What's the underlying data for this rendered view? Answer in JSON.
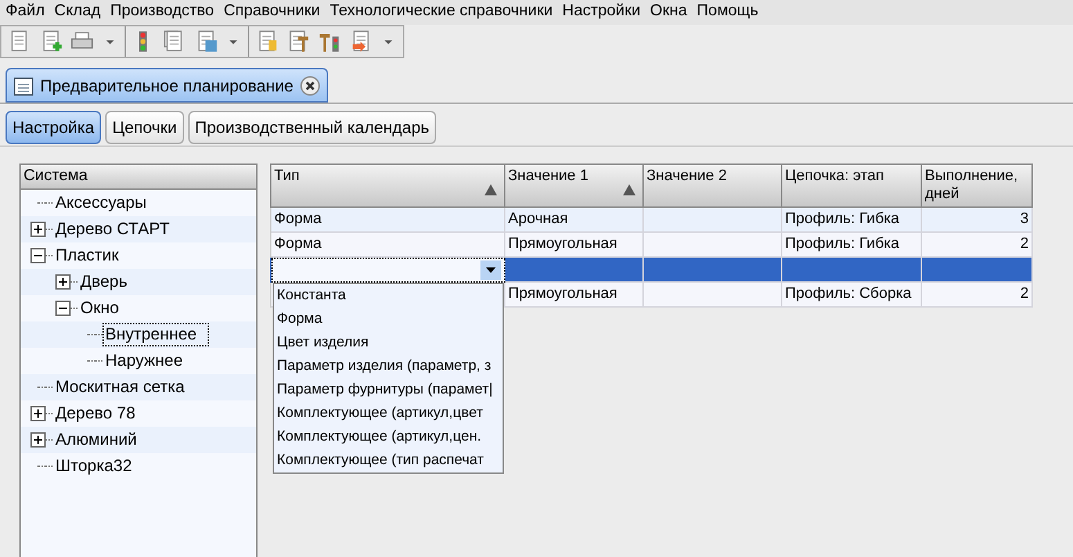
{
  "menu": [
    "Файл",
    "Склад",
    "Производство",
    "Справочники",
    "Технологические справочники",
    "Настройки",
    "Окна",
    "Помощь"
  ],
  "document_tab": {
    "title": "Предварительное планирование",
    "selected": true
  },
  "tabs": [
    {
      "label": "Настройка",
      "selected": true
    },
    {
      "label": "Цепочки",
      "selected": false
    },
    {
      "label": "Производственный календарь",
      "selected": false
    }
  ],
  "tree": {
    "header": "Система",
    "items": [
      {
        "label": "Аксессуары",
        "selected": false
      },
      {
        "label": "Дерево СТАРТ",
        "selected": false,
        "expanded": false
      },
      {
        "label": "Пластик",
        "selected": false,
        "expanded": true,
        "children": [
          {
            "label": "Дверь",
            "selected": false,
            "expanded": false
          },
          {
            "label": "Окно",
            "selected": false,
            "expanded": true,
            "children": [
              {
                "label": "Внутреннее",
                "selected": true
              },
              {
                "label": "Наружнее",
                "selected": false
              }
            ]
          }
        ]
      },
      {
        "label": "Москитная сетка",
        "selected": false
      },
      {
        "label": "Дерево 78",
        "selected": false,
        "expanded": false
      },
      {
        "label": "Алюминий",
        "selected": false,
        "expanded": false
      },
      {
        "label": "Шторка32",
        "selected": false
      }
    ]
  },
  "table": {
    "columns": [
      {
        "label": "Тип",
        "sorted": true
      },
      {
        "label": "Значение 1",
        "sorted": true
      },
      {
        "label": "Значение 2",
        "sorted": false
      },
      {
        "label": "Цепочка: этап",
        "sorted": false
      },
      {
        "label": "Выполнение, дней",
        "sorted": false
      }
    ],
    "rows": [
      {
        "cells": [
          "Форма",
          "Арочная",
          "",
          "Профиль: Гибка",
          "3"
        ],
        "selected": false
      },
      {
        "cells": [
          "Форма",
          "Прямоугольная",
          "",
          "Профиль: Гибка",
          "2"
        ],
        "selected": false
      },
      {
        "cells": [
          "",
          "",
          "",
          "",
          ""
        ],
        "selected": true
      },
      {
        "cells": [
          "",
          "Прямоугольная",
          "",
          "Профиль: Сборка",
          "2"
        ],
        "selected": false
      }
    ],
    "dropdown": {
      "options": [
        "Константа",
        "Форма",
        "Цвет изделия",
        "Параметр изделия (параметр, з",
        "Параметр фурнитуры (парамет|",
        "Комплектующее (артикул,цвет",
        "Комплектующее (артикул,цен.",
        "Комплектующее (тип распечат"
      ]
    }
  }
}
